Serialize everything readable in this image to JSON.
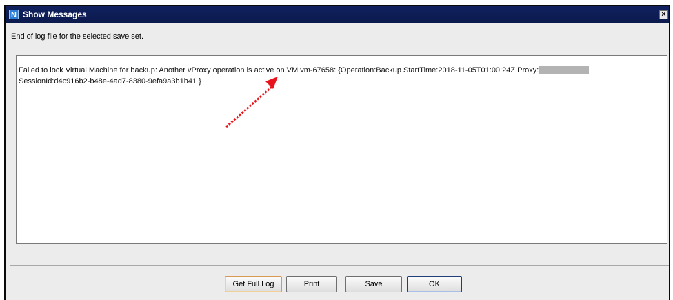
{
  "window": {
    "title": "Show Messages",
    "app_icon_letter": "N",
    "close_symbol": "×"
  },
  "header": {
    "text": "End of log file for the selected save set."
  },
  "log": {
    "line1": "Failed to lock Virtual Machine for backup: Another vProxy operation is active on VM vm-67658: {Operation:Backup StartTime:2018-11-05T01:00:24Z Proxy:",
    "line2": "SessionId:d4c916b2-b48e-4ad7-8380-9efa9a3b1b41 }"
  },
  "buttons": {
    "get_full_log": "Get Full Log",
    "print": "Print",
    "save": "Save",
    "ok": "OK"
  },
  "annotation": {
    "arrow_color": "#e8141b",
    "icon": "dotted-red-arrow-icon"
  }
}
